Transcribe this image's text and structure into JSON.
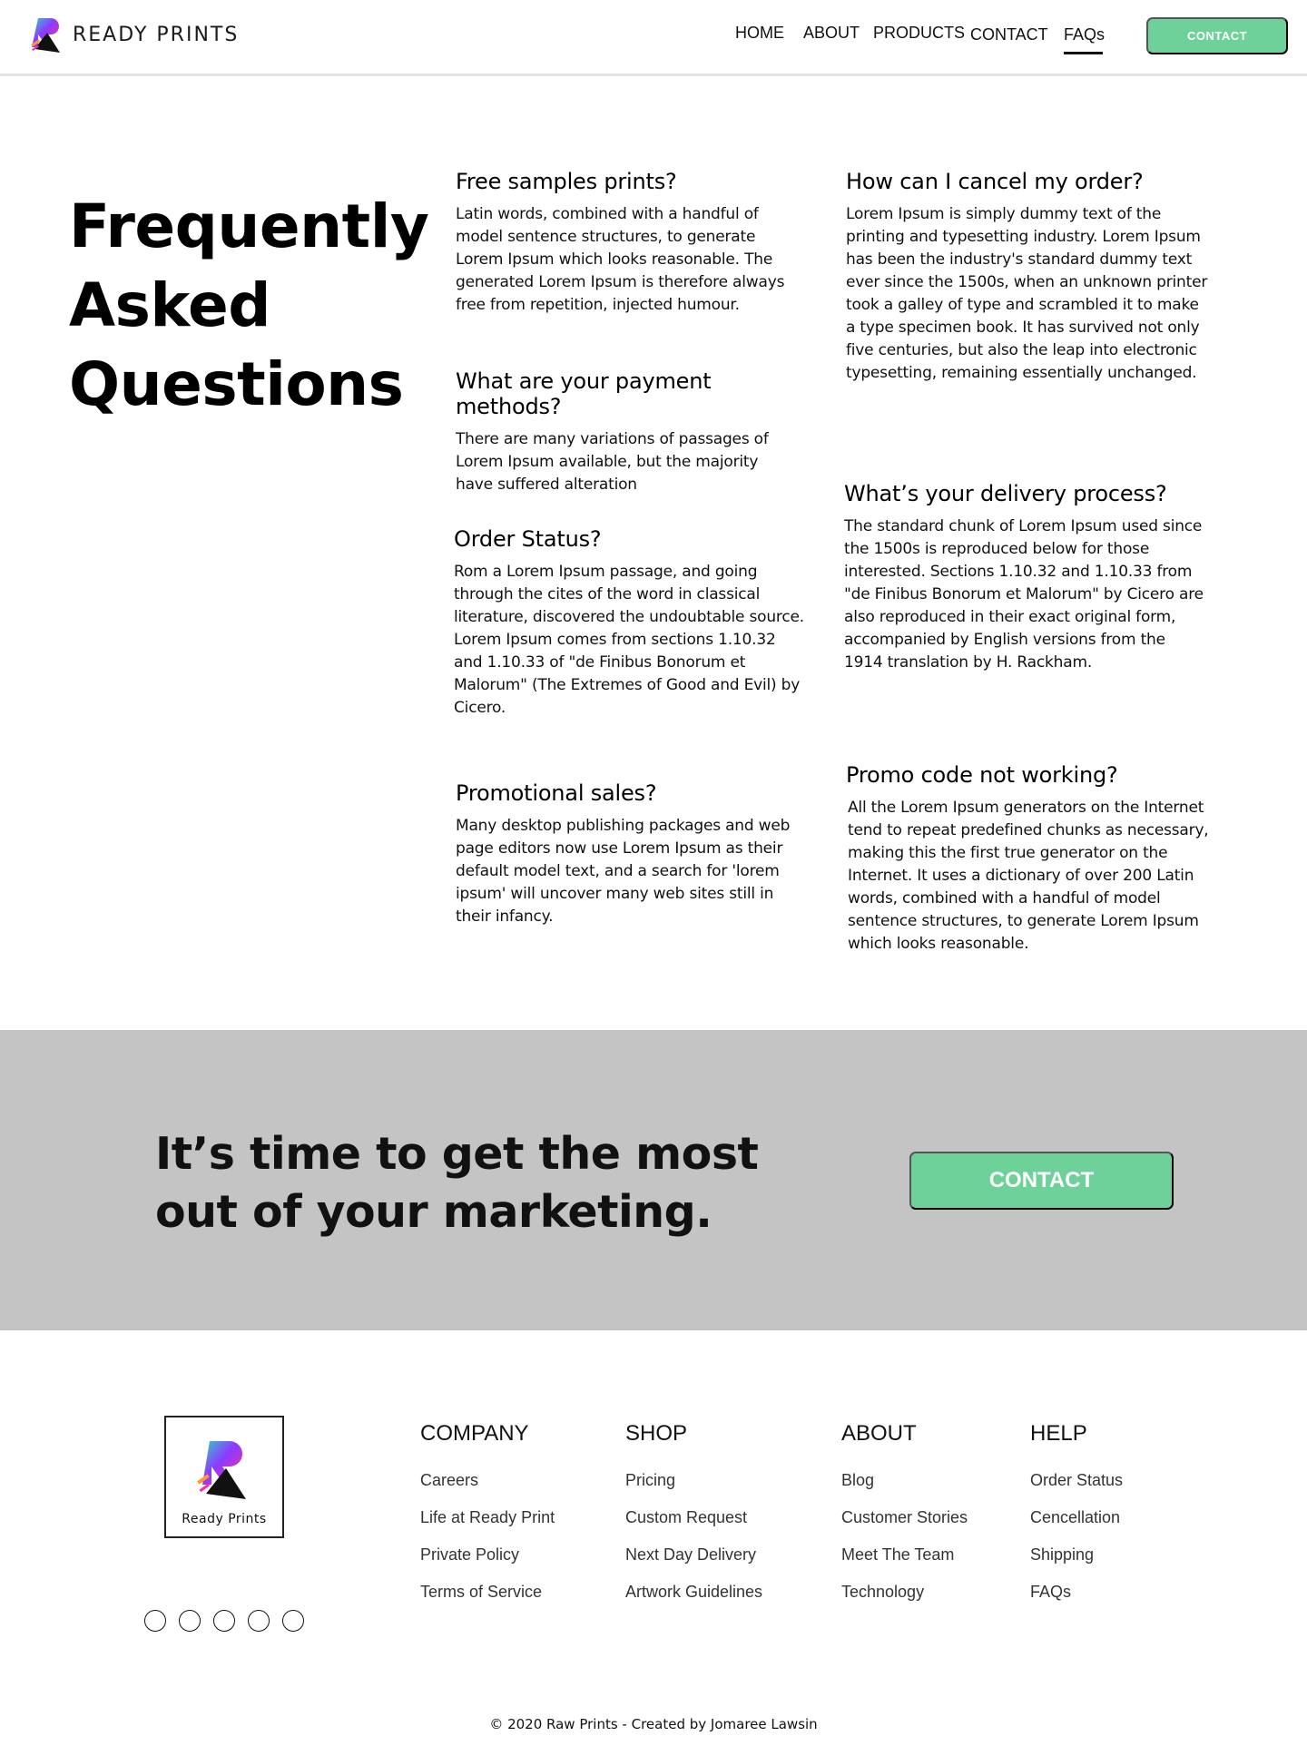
{
  "header": {
    "brand": "READY PRINTS",
    "nav": [
      "HOME",
      "ABOUT",
      "PRODUCTS",
      "CONTACT",
      "FAQs"
    ],
    "active_nav": "FAQs",
    "cta_label": "CONTACT"
  },
  "faq_section": {
    "title": "Frequently\nAsked\nQuestions",
    "items": [
      {
        "question": "Free samples prints?",
        "answer": "Latin words, combined with a handful of model sentence structures, to generate Lorem Ipsum which looks reasonable. The generated Lorem Ipsum is therefore always free from repetition, injected humour."
      },
      {
        "question": "What are your payment methods?",
        "answer": "There are many variations of passages of Lorem Ipsum available, but the majority have suffered alteration"
      },
      {
        "question": "Order Status?",
        "answer": "Rom a Lorem Ipsum passage, and going through the cites of the word in classical literature, discovered the undoubtable source. Lorem Ipsum comes from sections 1.10.32 and 1.10.33 of \"de Finibus Bonorum et Malorum\" (The Extremes of Good and Evil) by Cicero."
      },
      {
        "question": "Promotional sales?",
        "answer": "Many desktop publishing packages and web page editors now use Lorem Ipsum as their default model text, and a search for 'lorem ipsum' will uncover many web sites still in their infancy."
      },
      {
        "question": "How can I cancel my order?",
        "answer": "Lorem Ipsum is simply dummy text of the printing and typesetting industry. Lorem Ipsum has been the industry's standard dummy text ever since the 1500s, when an unknown printer took a galley of type and scrambled it to make a type specimen book. It has survived not only five centuries, but also the leap into electronic typesetting, remaining essentially unchanged."
      },
      {
        "question": "What’s your delivery process?",
        "answer": "The standard chunk of Lorem Ipsum used since the 1500s is reproduced below for those interested. Sections 1.10.32 and 1.10.33 from \"de Finibus Bonorum et Malorum\" by Cicero are also reproduced in their exact original form, accompanied by English versions from the 1914 translation by H. Rackham."
      },
      {
        "question": "Promo code not working?",
        "answer": "All the Lorem Ipsum generators on the Internet tend to repeat predefined chunks as necessary, making this the first true generator on the Internet. It uses a dictionary of over 200 Latin words, combined with a handful of model sentence structures, to generate Lorem Ipsum which looks reasonable."
      }
    ]
  },
  "cta": {
    "text": "It’s time to get the most out of your marketing.",
    "button_label": "CONTACT"
  },
  "footer": {
    "logo_text": "Ready Prints",
    "social_count": 5,
    "columns": [
      {
        "heading": "COMPANY",
        "links": [
          "Careers",
          "Life at Ready Print",
          "Private Policy",
          "Terms of Service"
        ]
      },
      {
        "heading": "SHOP",
        "links": [
          "Pricing",
          "Custom Request",
          "Next Day Delivery",
          "Artwork Guidelines"
        ]
      },
      {
        "heading": "ABOUT",
        "links": [
          "Blog",
          "Customer Stories",
          "Meet The Team",
          "Technology"
        ]
      },
      {
        "heading": "HELP",
        "links": [
          "Order Status",
          "Cencellation",
          "Shipping",
          "FAQs"
        ]
      }
    ],
    "copyright": "© 2020 Raw Prints - Created by Jomaree Lawsin"
  },
  "colors": {
    "accent_green": "#6fd19a",
    "cta_background": "#c4c4c4",
    "logo_gradient": [
      "#ff2aa0",
      "#8a3cff",
      "#32d2c8"
    ]
  },
  "icons": {
    "brand_logo": "ready-prints-logo-icon",
    "social": "social-circle-icon"
  }
}
